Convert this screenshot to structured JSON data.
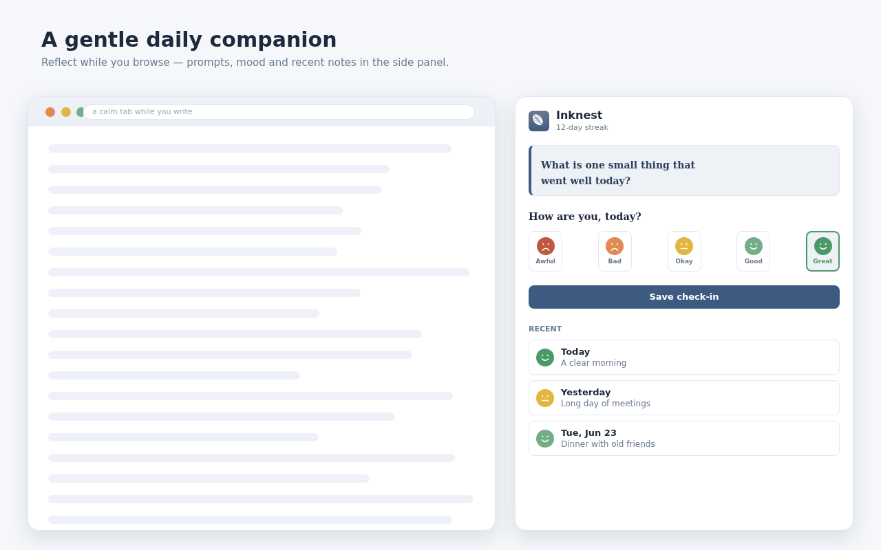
{
  "header": {
    "title": "A gentle daily companion",
    "subtitle": "Reflect while you browse — prompts, mood and recent notes in the side panel."
  },
  "browser": {
    "address_bar": {
      "placeholder": "a calm tab while you write"
    }
  },
  "side_panel": {
    "app": {
      "name": "Inknest",
      "streak": "12-day streak"
    },
    "prompt": "What is one small thing that went well today?",
    "mood_question": "How are you, today?",
    "moods": [
      {
        "label": "Awful",
        "kind": "frown",
        "color": "#c0583f",
        "selected": false
      },
      {
        "label": "Bad",
        "kind": "frown",
        "color": "#e08a56",
        "selected": false
      },
      {
        "label": "Okay",
        "kind": "neutral",
        "color": "#e3b541",
        "selected": false
      },
      {
        "label": "Good",
        "kind": "smile",
        "color": "#74ae86",
        "selected": false
      },
      {
        "label": "Great",
        "kind": "smile",
        "color": "#4a9a68",
        "selected": true
      }
    ],
    "save_button": "Save check-in",
    "recent_heading": "RECENT",
    "recent": [
      {
        "title": "Today",
        "note": "A clear morning",
        "kind": "smile",
        "color": "#4a9a68"
      },
      {
        "title": "Yesterday",
        "note": "Long day of meetings",
        "kind": "neutral",
        "color": "#e3b541"
      },
      {
        "title": "Tue, Jun 23",
        "note": "Dinner with old friends",
        "kind": "smile",
        "color": "#74ae86"
      }
    ]
  }
}
